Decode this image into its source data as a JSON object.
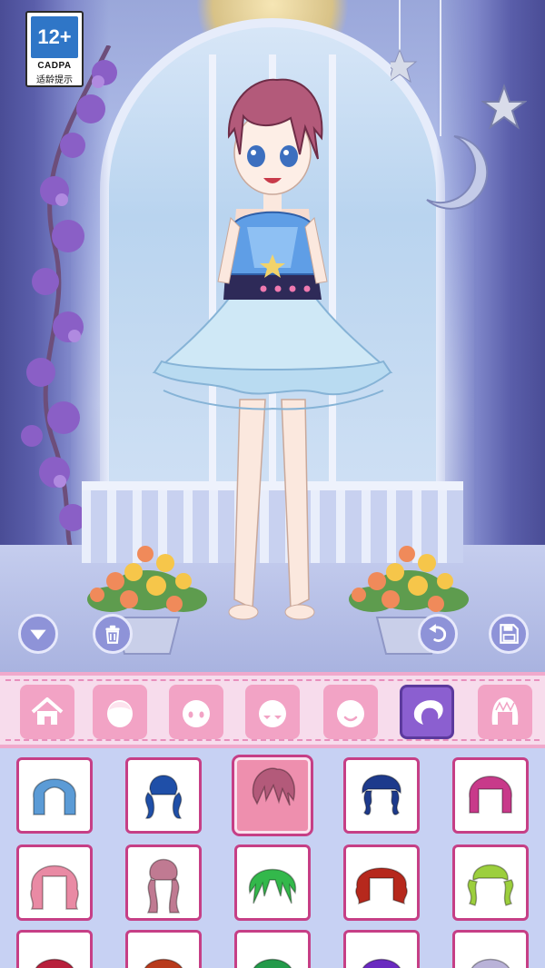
{
  "age_rating": {
    "label": "12+",
    "org": "CADPA",
    "note": "适龄提示"
  },
  "stage_controls": [
    {
      "name": "collapse-button",
      "icon": "chevron-down-icon"
    },
    {
      "name": "trash-button",
      "icon": "trash-icon"
    },
    {
      "name": "undo-button",
      "icon": "undo-icon"
    },
    {
      "name": "save-button",
      "icon": "save-disk-icon"
    }
  ],
  "categories": [
    {
      "icon": "home-icon",
      "active": false
    },
    {
      "icon": "face-base-icon",
      "active": false
    },
    {
      "icon": "face-eyes-icon",
      "active": false
    },
    {
      "icon": "face-blush-icon",
      "active": false
    },
    {
      "icon": "face-smile-icon",
      "active": false
    },
    {
      "icon": "hair-icon",
      "active": true
    },
    {
      "icon": "hair-back-icon",
      "active": false
    }
  ],
  "hair_items": [
    {
      "color": "#5b9bd6",
      "style": "bob",
      "selected": false
    },
    {
      "color": "#1f4fa8",
      "style": "pigtails",
      "selected": false
    },
    {
      "color": "#b35a7a",
      "style": "spiky-short",
      "selected": true
    },
    {
      "color": "#1d3a8c",
      "style": "braids",
      "selected": false
    },
    {
      "color": "#c83a8a",
      "style": "bob-bangs",
      "selected": false
    },
    {
      "color": "#e98aa4",
      "style": "wavy-medium",
      "selected": false
    },
    {
      "color": "#c07a92",
      "style": "long-twin-curls",
      "selected": false
    },
    {
      "color": "#33b84b",
      "style": "layered",
      "selected": false
    },
    {
      "color": "#b6281c",
      "style": "curly-medium",
      "selected": false
    },
    {
      "color": "#9ccf3d",
      "style": "side-tails",
      "selected": false
    },
    {
      "color": "#b8203c",
      "style": "partial",
      "selected": false
    },
    {
      "color": "#b83a1c",
      "style": "partial",
      "selected": false
    },
    {
      "color": "#239a4a",
      "style": "partial",
      "selected": false
    },
    {
      "color": "#6a2ac0",
      "style": "partial",
      "selected": false
    },
    {
      "color": "#b9b2d8",
      "style": "partial",
      "selected": false
    }
  ],
  "colors": {
    "accent": "#c63f86",
    "active_tab": "#8b5fd0",
    "tab": "#f2a3c5",
    "bar_bg": "#f7dcec"
  }
}
